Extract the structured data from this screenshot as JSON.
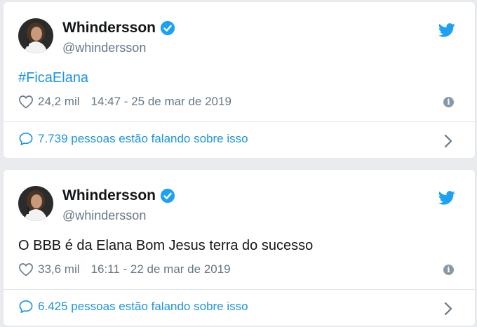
{
  "tweets": [
    {
      "display_name": "Whindersson",
      "handle": "@whindersson",
      "text": "#FicaElana",
      "likes": "24,2 mil",
      "timestamp": "14:47 - 25 de mar de 2019",
      "conversation": "7.739 pessoas estão falando sobre isso"
    },
    {
      "display_name": "Whindersson",
      "handle": "@whindersson",
      "text": "O BBB é da Elana Bom Jesus terra do sucesso",
      "likes": "33,6 mil",
      "timestamp": "16:11 - 22 de mar de 2019",
      "conversation": "6.425 pessoas estão falando sobre isso"
    }
  ],
  "icons": {
    "verified": "verified-badge-icon",
    "brand": "twitter-bird-icon",
    "like": "heart-icon",
    "info": "info-icon",
    "conversation": "speech-bubble-icon",
    "next": "chevron-right-icon"
  },
  "colors": {
    "accent": "#1b95e0",
    "name_text": "#14171a",
    "secondary_text": "#657786",
    "twitter_blue": "#1da1f2"
  }
}
